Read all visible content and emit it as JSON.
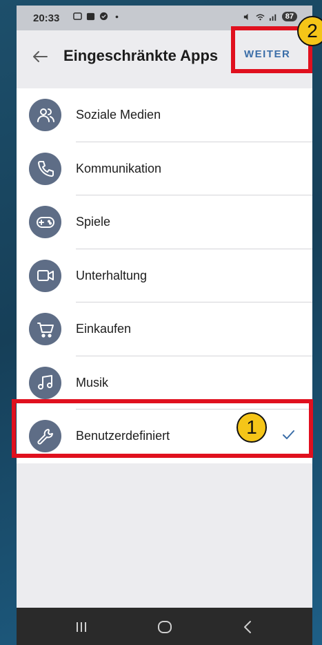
{
  "status_bar": {
    "time": "20:33",
    "battery": "87"
  },
  "app_bar": {
    "title": "Eingeschränkte Apps",
    "next_label": "WEITER"
  },
  "categories": [
    {
      "label": "Soziale Medien",
      "icon": "people-icon",
      "selected": false
    },
    {
      "label": "Kommunikation",
      "icon": "phone-icon",
      "selected": false
    },
    {
      "label": "Spiele",
      "icon": "gamepad-icon",
      "selected": false
    },
    {
      "label": "Unterhaltung",
      "icon": "video-camera-icon",
      "selected": false
    },
    {
      "label": "Einkaufen",
      "icon": "shopping-cart-icon",
      "selected": false
    },
    {
      "label": "Musik",
      "icon": "music-note-icon",
      "selected": false
    },
    {
      "label": "Benutzerdefiniert",
      "icon": "wrench-icon",
      "selected": true
    }
  ],
  "annotations": [
    {
      "number": "1",
      "color": "#f5c518",
      "box_color": "#e0101e"
    },
    {
      "number": "2",
      "color": "#f5c518",
      "box_color": "#e0101e"
    }
  ]
}
